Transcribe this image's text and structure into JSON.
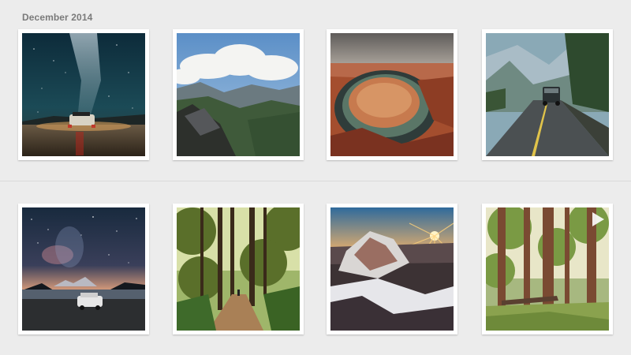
{
  "section": {
    "title": "December 2014"
  },
  "photos": [
    {
      "id_label": "milky-way-car-photo"
    },
    {
      "id_label": "mountain-clouds-photo"
    },
    {
      "id_label": "horseshoe-bend-photo"
    },
    {
      "id_label": "mountain-road-jeep-photo"
    },
    {
      "id_label": "starry-lake-car-photo"
    },
    {
      "id_label": "forest-trail-photo"
    },
    {
      "id_label": "sunrise-mountain-photo"
    },
    {
      "id_label": "redwood-forest-video",
      "is_video": true,
      "icon": "play-icon"
    }
  ]
}
